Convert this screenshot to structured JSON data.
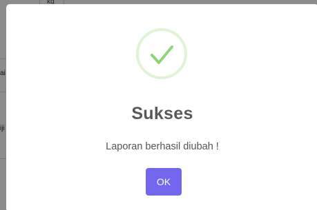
{
  "background": {
    "cell_text": "kg",
    "row_texts": [
      "ai",
      "iji"
    ]
  },
  "dialog": {
    "icon": "checkmark-icon",
    "title": "Sukses",
    "message": "Laporan berhasil diubah !",
    "confirm_label": "OK"
  },
  "colors": {
    "accent": "#7367f0",
    "success": "#a5dc86",
    "title": "#595959",
    "text": "#545454"
  }
}
